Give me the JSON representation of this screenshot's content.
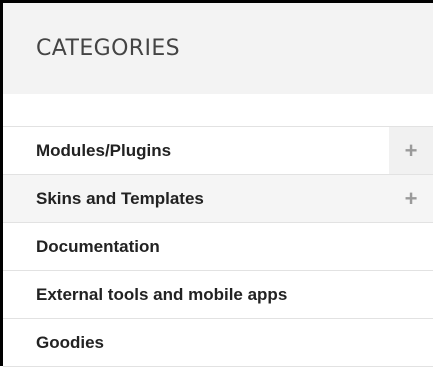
{
  "header": {
    "title": "CATEGORIES"
  },
  "categories": [
    {
      "label": "Modules/Plugins",
      "expandable": true,
      "expand_symbol": "+"
    },
    {
      "label": "Skins and Templates",
      "expandable": true,
      "expand_symbol": "+"
    },
    {
      "label": "Documentation",
      "expandable": false
    },
    {
      "label": "External tools and mobile apps",
      "expandable": false
    },
    {
      "label": "Goodies",
      "expandable": false
    }
  ]
}
